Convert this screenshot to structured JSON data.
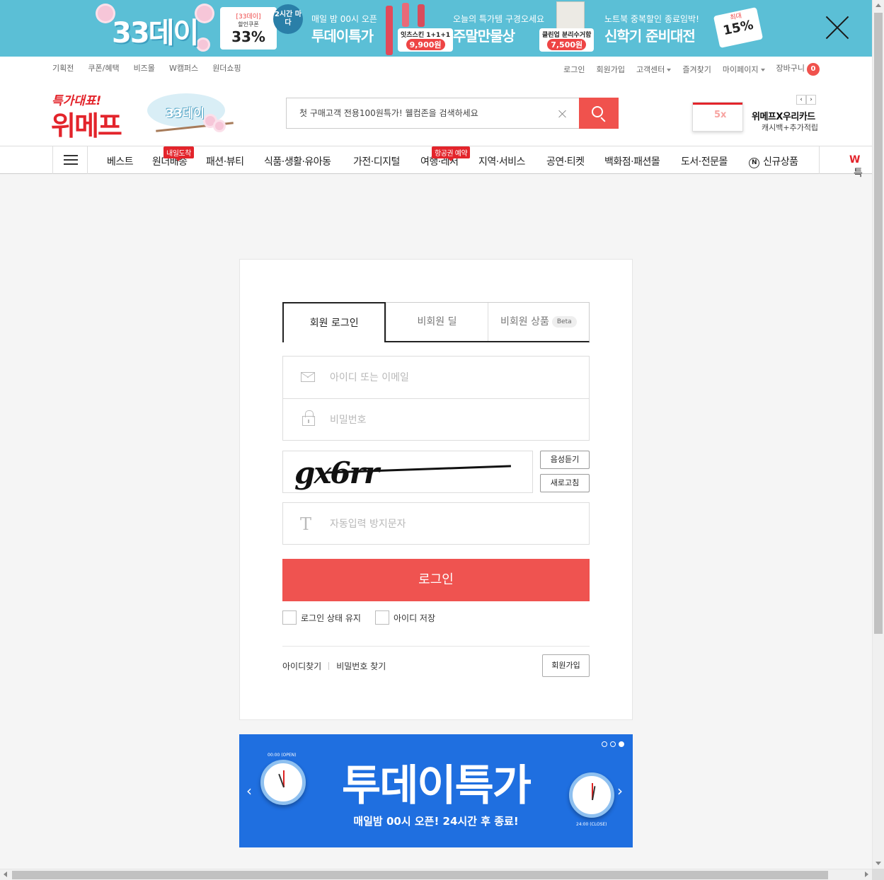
{
  "top_banner": {
    "event_title": "33데이",
    "coupon_tag": "[33데이]",
    "coupon_label": "할인쿠폰",
    "coupon_pct": "33%",
    "badge": "2시간 마다",
    "sec1_small": "매일 밤 00시 오픈",
    "sec1_big": "투데이특가",
    "sec1_item": "잇츠스킨 1+1+1",
    "sec1_price": "9,900원",
    "sec2_small": "오늘의 특가템 구경오세요",
    "sec2_big": "주말만물상",
    "sec2_item": "클린업 분리수거함",
    "sec2_price": "7,500원",
    "sec3_small": "노트북 중복할인 종료임박!",
    "sec3_big": "신학기 준비대전",
    "sec3_max": "최대",
    "sec3_pct": "15%",
    "close_icon": "close-icon"
  },
  "util": {
    "left": [
      "기획전",
      "쿠폰/혜택",
      "비즈몰",
      "W캠퍼스",
      "원더쇼핑"
    ],
    "login": "로그인",
    "signup": "회원가입",
    "customer_center": "고객센터",
    "favorites": "즐겨찾기",
    "mypage": "마이페이지",
    "cart": "장바구니",
    "cart_count": "0"
  },
  "header": {
    "logo_tag": "특가대표!",
    "logo_main": "위메프",
    "event_logo": "33데이",
    "search_placeholder": "첫 구매고객 전용100원특가! 웰컴존을 검색하세요",
    "search_icon": "search-icon",
    "ad_prev": "‹",
    "ad_next": "›",
    "ad_card_text": "5x",
    "ad_title": "위메프X우리카드",
    "ad_sub": "캐시백+추가적립"
  },
  "gnb": {
    "menu_icon": "hamburger-icon",
    "items": [
      "베스트",
      "원더배송",
      "패션·뷰티",
      "식품·생활·유아동",
      "가전·디지털",
      "여행·레저",
      "지역·서비스",
      "공연·티켓",
      "백화점·패션몰",
      "도서·전문몰",
      "신규상품"
    ],
    "tag_wonder": "내일도착",
    "tag_travel": "항공권 예약",
    "new_icon_letter": "N",
    "w_logo": "W",
    "w_suffix": "특"
  },
  "login": {
    "tabs": [
      "회원 로그인",
      "비회원 딜",
      "비회원 상품"
    ],
    "beta": "Beta",
    "id_placeholder": "아이디 또는 이메일",
    "pw_placeholder": "비밀번호",
    "captcha_text": "gx6rr",
    "audio_btn": "음성듣기",
    "refresh_btn": "새로고침",
    "captcha_placeholder": "자동입력 방지문자",
    "captcha_icon_glyph": "T",
    "login_btn": "로그인",
    "keep_login": "로그인 상태 유지",
    "save_id": "아이디 저장",
    "find_id": "아이디찾기",
    "find_pw": "비밀번호 찾기",
    "join_btn": "회원가입"
  },
  "promo": {
    "title": "투데이특가",
    "sub": "매일밤 00시 오픈! 24시간 후 종료!",
    "open_label": "00:00 (OPEN)",
    "close_label": "24:00 (CLOSE)",
    "prev": "‹",
    "next": "›",
    "active_slide": 3,
    "slide_count": 3
  },
  "colors": {
    "brand_red": "#e3242b",
    "login_btn": "#ef5350",
    "banner_bg": "#5bbfd6",
    "promo_bg": "#1f6fe0"
  }
}
